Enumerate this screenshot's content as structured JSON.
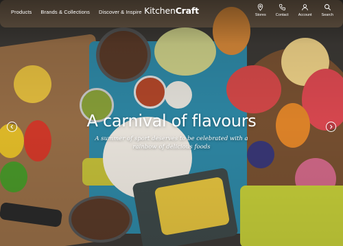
{
  "nav": {
    "products": "Products",
    "brands": "Brands & Collections",
    "discover": "Discover & Inspire"
  },
  "brand": {
    "light": "Kitchen",
    "bold": "Craft"
  },
  "utility": {
    "stores": "Stores",
    "contact": "Contact",
    "account": "Account",
    "search": "Search"
  },
  "hero": {
    "headline": "A carnival of flavours",
    "subline_1": "A summer of sport deserves to be celebrated with a",
    "subline_2": "rainbow of delicious foods"
  },
  "icons": {
    "stores": "map-pin-icon",
    "contact": "phone-icon",
    "account": "user-icon",
    "search": "search-icon",
    "prev": "chevron-left-icon",
    "next": "chevron-right-icon"
  }
}
